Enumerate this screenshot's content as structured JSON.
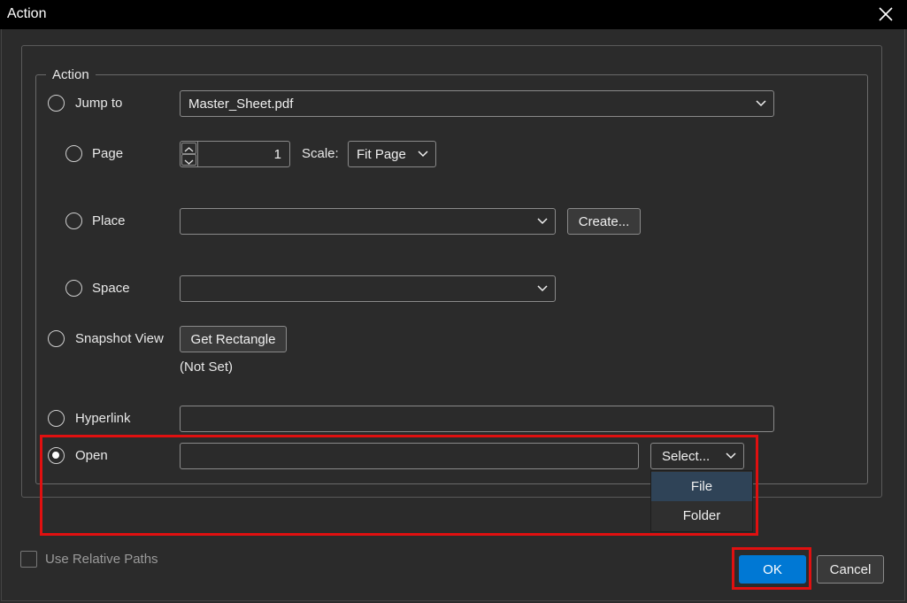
{
  "window": {
    "title": "Action"
  },
  "group": {
    "legend": "Action"
  },
  "jump_to": {
    "label": "Jump to",
    "value": "Master_Sheet.pdf"
  },
  "page": {
    "label": "Page",
    "value": "1",
    "scale_label": "Scale:",
    "scale_value": "Fit Page"
  },
  "place": {
    "label": "Place",
    "value": "",
    "create_label": "Create..."
  },
  "space": {
    "label": "Space",
    "value": ""
  },
  "snapshot": {
    "label": "Snapshot View",
    "button_label": "Get Rectangle",
    "status": "(Not Set)"
  },
  "hyperlink": {
    "label": "Hyperlink",
    "value": ""
  },
  "open": {
    "label": "Open",
    "value": "",
    "select_label": "Select...",
    "selected": true
  },
  "select_menu": {
    "items": [
      "File",
      "Folder"
    ],
    "highlighted": "File"
  },
  "footer": {
    "relative_paths_label": "Use Relative Paths",
    "ok_label": "OK",
    "cancel_label": "Cancel"
  },
  "colors": {
    "accent": "#0078d4",
    "highlight_box": "#e01010",
    "background": "#2b2b2b"
  }
}
